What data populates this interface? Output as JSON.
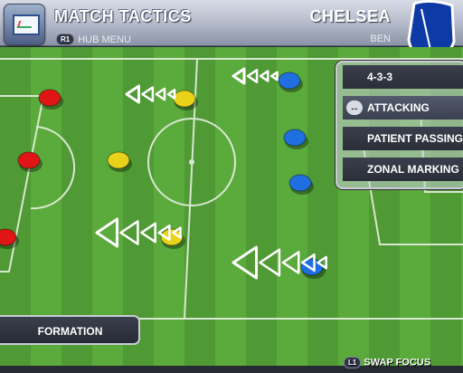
{
  "header": {
    "title": "MATCH TACTICS",
    "team": "CHELSEA",
    "hub_button": "R1",
    "hub_label": "HUB MENU",
    "coach": "BEN"
  },
  "tactics_menu": {
    "items": [
      {
        "label": "4-3-3",
        "selected": false,
        "icon": null
      },
      {
        "label": "ATTACKING",
        "selected": true,
        "icon": "swap-arrows-icon"
      },
      {
        "label": "PATIENT PASSING",
        "selected": false,
        "icon": null
      },
      {
        "label": "ZONAL MARKING",
        "selected": false,
        "icon": null
      }
    ]
  },
  "formation_button": {
    "label": "FORMATION"
  },
  "footer": {
    "swap_button": "L1",
    "swap_label": "SWAP FOCUS"
  },
  "colors": {
    "defenders": "#e01616",
    "midfielders": "#e8d21a",
    "forwards": "#1f6fe0",
    "pitch": "#52a238"
  }
}
